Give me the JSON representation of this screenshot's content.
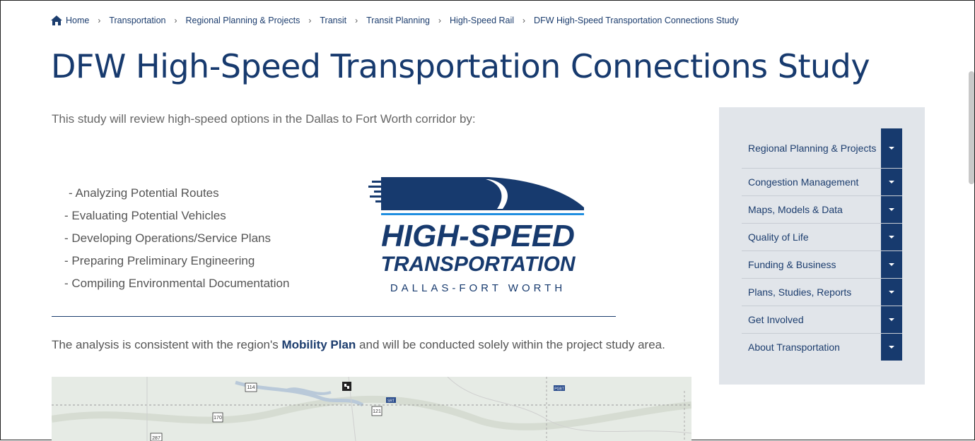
{
  "breadcrumb": {
    "items": [
      "Home",
      "Transportation",
      "Regional Planning & Projects",
      "Transit",
      "Transit Planning",
      "High-Speed Rail"
    ],
    "current": "DFW High-Speed Transportation Connections Study",
    "separator": "›"
  },
  "page": {
    "title": "DFW High-Speed Transportation Connections Study",
    "intro": "This study will review high-speed options in the Dallas to Fort Worth corridor by:",
    "tasks": [
      "- Analyzing Potential Routes",
      "- Evaluating Potential Vehicles",
      "- Developing Operations/Service Plans",
      "- Preparing Preliminary Engineering",
      "- Compiling Environmental Documentation"
    ],
    "analysis_before": "The analysis is consistent with the region's ",
    "analysis_link": "Mobility Plan",
    "analysis_after": " and will be conducted solely within the project study area."
  },
  "logo": {
    "line1": "HIGH-SPEED",
    "line2": "TRANSPORTATION",
    "line3": "DALLAS-FORT WORTH"
  },
  "sidebar": {
    "items": [
      {
        "label": "Regional Planning & Projects"
      },
      {
        "label": "Congestion Management"
      },
      {
        "label": "Maps, Models & Data"
      },
      {
        "label": "Quality of Life"
      },
      {
        "label": "Funding & Business"
      },
      {
        "label": "Plans, Studies, Reports"
      },
      {
        "label": "Get Involved"
      },
      {
        "label": "About Transportation"
      }
    ]
  },
  "map": {
    "labels": [
      "114",
      "121",
      "170",
      "SRT",
      "PGBT",
      "287"
    ]
  },
  "colors": {
    "brand": "#173a6e",
    "sidebar_bg": "#e1e5ea",
    "text": "#555555"
  }
}
